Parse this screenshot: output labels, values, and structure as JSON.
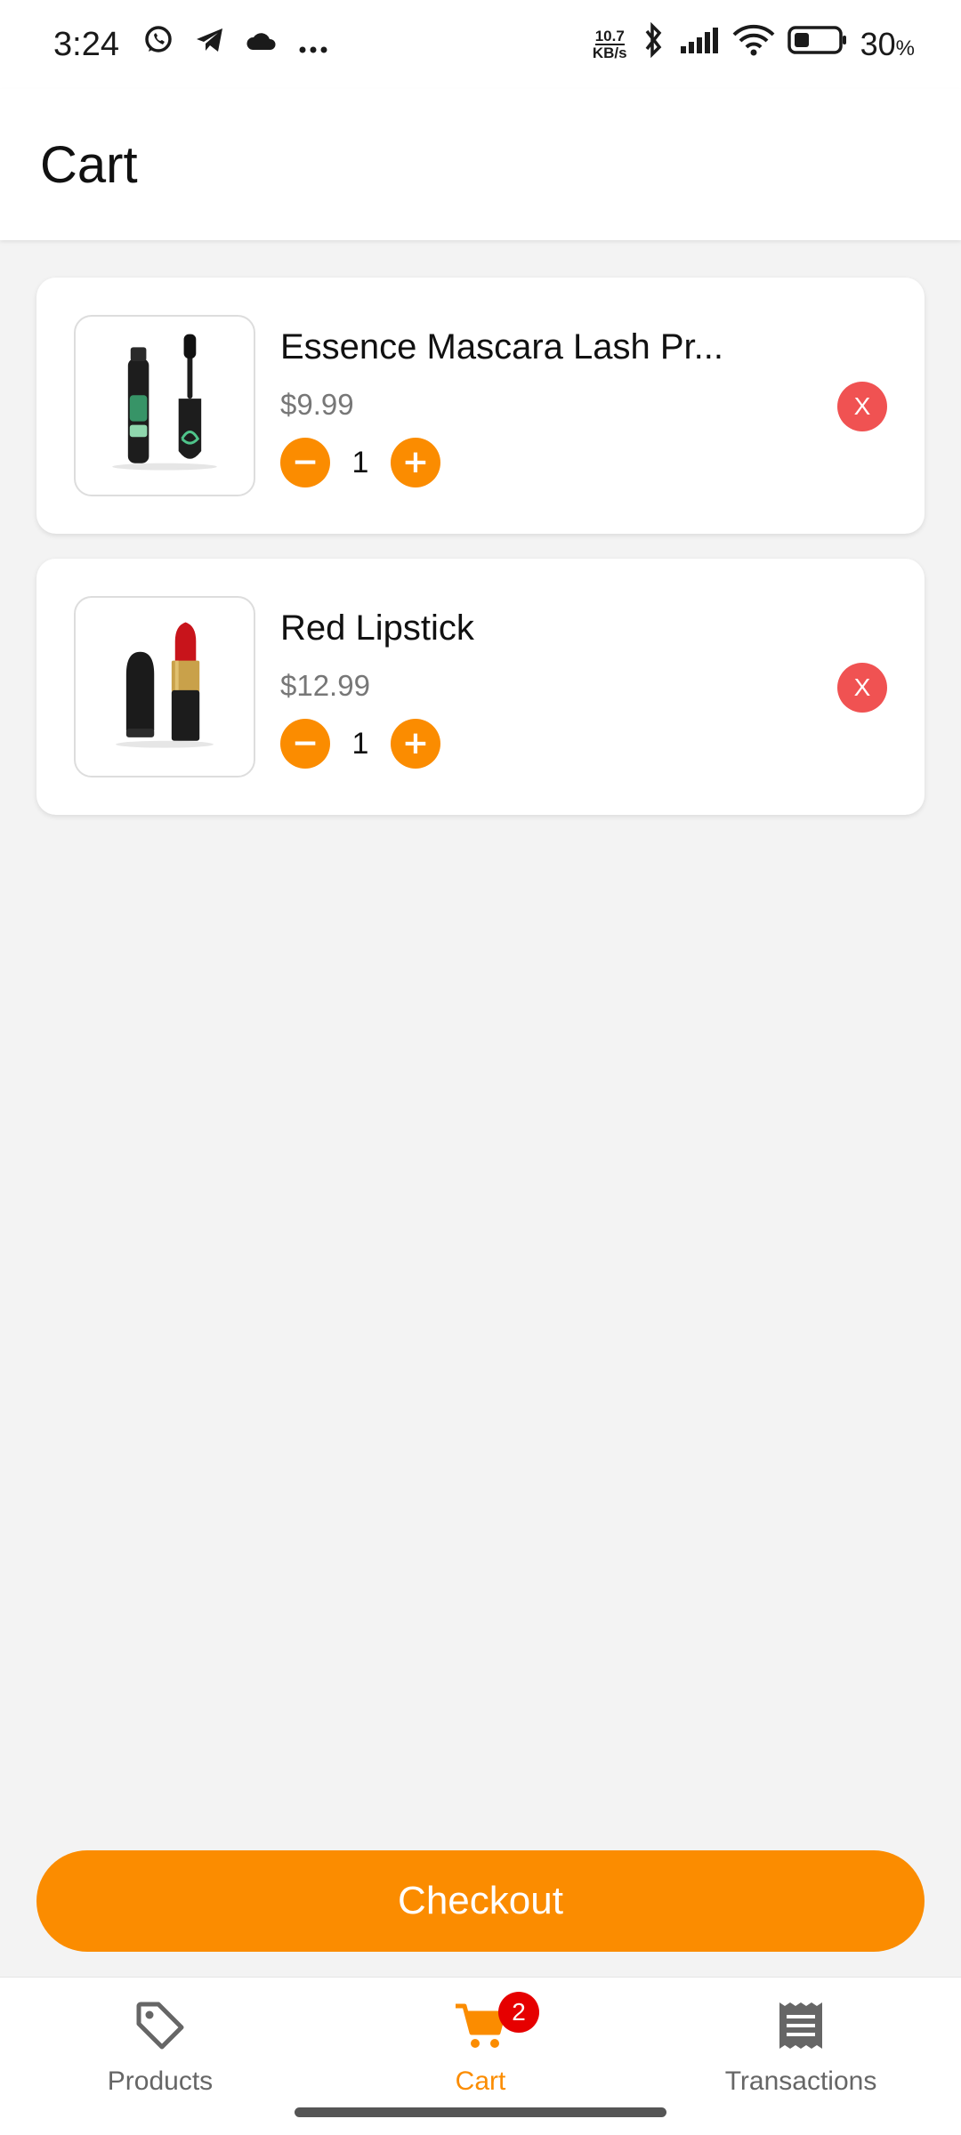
{
  "status_bar": {
    "time": "3:24",
    "net_speed_value": "10.7",
    "net_speed_unit": "KB/s",
    "battery_percent": "30",
    "battery_unit": "%",
    "icons": [
      "whatsapp-icon",
      "telegram-icon",
      "cloud-icon",
      "more-icon",
      "bluetooth-icon",
      "signal-icon",
      "wifi-icon",
      "battery-icon"
    ]
  },
  "header": {
    "title": "Cart"
  },
  "cart": {
    "items": [
      {
        "name": "Essence Mascara Lash Pr...",
        "price": "$9.99",
        "quantity": "1",
        "remove_label": "X",
        "decrease_label": "−",
        "increase_label": "+"
      },
      {
        "name": "Red Lipstick",
        "price": "$12.99",
        "quantity": "1",
        "remove_label": "X",
        "decrease_label": "−",
        "increase_label": "+"
      }
    ]
  },
  "checkout": {
    "label": "Checkout"
  },
  "bottom_nav": {
    "items": [
      {
        "label": "Products",
        "icon": "tag-icon",
        "active": false
      },
      {
        "label": "Cart",
        "icon": "cart-icon",
        "active": true,
        "badge": "2"
      },
      {
        "label": "Transactions",
        "icon": "receipt-icon",
        "active": false
      }
    ]
  },
  "colors": {
    "accent": "#fb8c00",
    "remove": "#f05252",
    "badge": "#e60000",
    "background": "#f3f3f3"
  }
}
